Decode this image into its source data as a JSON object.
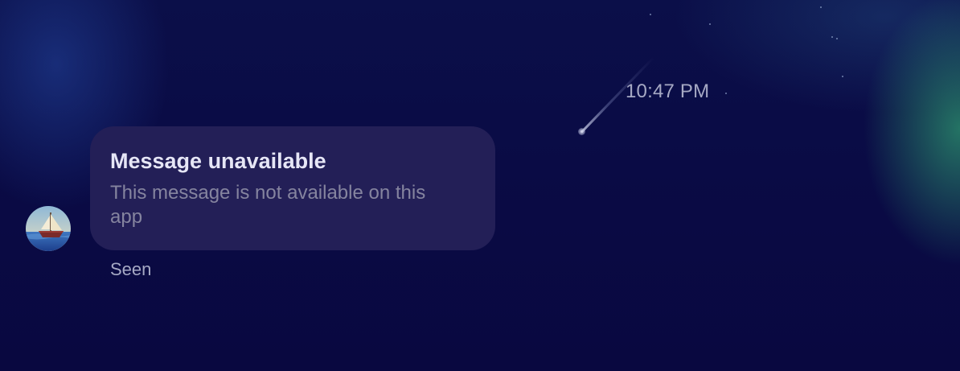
{
  "thread": {
    "timestamp": "10:47 PM",
    "message": {
      "title": "Message unavailable",
      "body": "This message is not available on this app",
      "status": "Seen"
    },
    "sender_avatar_icon": "sailboat-avatar-icon"
  },
  "colors": {
    "background": "#0a0b45",
    "bubble": "#231f57",
    "title_text": "#e6e6f6",
    "body_text": "#85849f",
    "meta_text": "#a6a9c4"
  }
}
